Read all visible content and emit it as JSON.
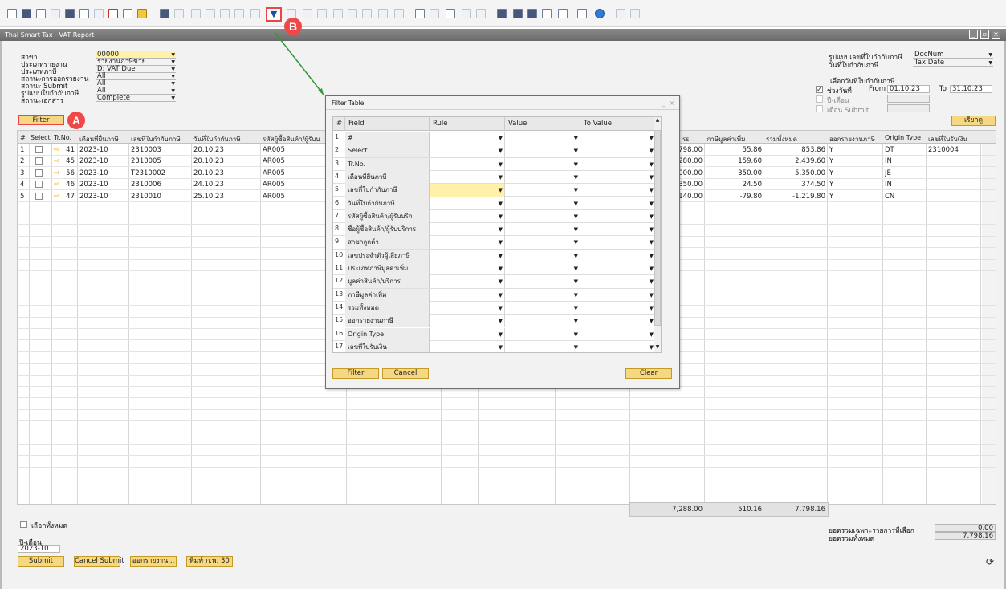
{
  "toolbar": {
    "filter_icon": "filter-icon"
  },
  "callouts": {
    "a": "A",
    "b": "B"
  },
  "window": {
    "title": "Thai Smart Tax - VAT Report"
  },
  "criteria": {
    "labels": [
      "สาขา",
      "ประเภทรายงาน",
      "ประเภทภาษี",
      "สถานะการออกรายงาน",
      "สถานะ Submit",
      "รูปแบบใบกำกับภาษี",
      "สถานะเอกสาร"
    ],
    "values": [
      "00000",
      "รายงานภาษีขาย",
      "D: VAT Due",
      "All",
      "All",
      "All",
      "Complete"
    ],
    "filter_button": "Filter"
  },
  "right_criteria": {
    "labels": [
      "รูปแบบเลขที่ใบกำกับภาษี",
      "วันที่ใบกำกับภาษี"
    ],
    "values": [
      "DocNum",
      "Tax Date"
    ],
    "group_title": "เลือกวันที่ใบกำกับภาษี",
    "opt1": "ช่วงวันที่",
    "opt2": "ปี-เดือน",
    "opt3": "เดือน Submit",
    "from_label": "From",
    "from_value": "01.10.23",
    "to_label": "To",
    "to_value": "31.10.23",
    "search_button": "เรียกดู"
  },
  "grid": {
    "headers": [
      "#",
      "Select",
      "Tr.No.",
      "เดือนที่ยื่นภาษี",
      "เลขที่ใบกำกับภาษี",
      "วันที่ใบกำกับภาษี",
      "รหัสผู้ซื้อสินค้า/ผู้รับบ",
      "",
      "",
      "",
      "",
      "",
      "",
      "รวมทั้งหมด",
      "ออกรายงานภาษี",
      "Origin Type",
      "เลขที่ใบรับเงิน"
    ],
    "rows": [
      {
        "n": "1",
        "tr": "41",
        "month": "2023-10",
        "inv": "2310003",
        "date": "20.10.23",
        "cust": "AR005",
        "amt": "798.00",
        "vat": "55.86",
        "total": "853.86",
        "issued": "Y",
        "origin": "DT",
        "rcpt": "2310004"
      },
      {
        "n": "2",
        "tr": "45",
        "month": "2023-10",
        "inv": "2310005",
        "date": "20.10.23",
        "cust": "AR005",
        "amt": "280.00",
        "vat": "159.60",
        "total": "2,439.60",
        "issued": "Y",
        "origin": "IN",
        "rcpt": ""
      },
      {
        "n": "3",
        "tr": "56",
        "month": "2023-10",
        "inv": "T2310002",
        "date": "20.10.23",
        "cust": "AR005",
        "amt": "000.00",
        "vat": "350.00",
        "total": "5,350.00",
        "issued": "Y",
        "origin": "JE",
        "rcpt": ""
      },
      {
        "n": "4",
        "tr": "46",
        "month": "2023-10",
        "inv": "2310006",
        "date": "24.10.23",
        "cust": "AR005",
        "amt": "350.00",
        "vat": "24.50",
        "total": "374.50",
        "issued": "Y",
        "origin": "IN",
        "rcpt": ""
      },
      {
        "n": "5",
        "tr": "47",
        "month": "2023-10",
        "inv": "2310010",
        "date": "25.10.23",
        "cust": "AR005",
        "amt": "140.00",
        "vat": "-79.80",
        "total": "-1,219.80",
        "issued": "Y",
        "origin": "CN",
        "rcpt": ""
      }
    ],
    "hdr_partial_rs": "รs",
    "hdr_vat": "ภาษีมูลค่าเพิ่ม",
    "totals": {
      "amount": "7,288.00",
      "vat": "510.16",
      "total": "7,798.16"
    }
  },
  "bottom": {
    "select_all": "เลือกทั้งหมด",
    "period_label": "ปี-เดือน",
    "period_value": "2023-10",
    "buttons": [
      "Submit",
      "Cancel Submit",
      "ออกรายงาน...",
      "พิมพ์ ภ.พ. 30"
    ],
    "sum_selected_label": "ยอดรวมเฉพาะรายการที่เลือก",
    "sum_selected_value": "0.00",
    "sum_all_label": "ยอดรวมทั้งหมด",
    "sum_all_value": "7,798.16"
  },
  "dialog": {
    "title": "Filter Table",
    "headers": [
      "#",
      "Field",
      "Rule",
      "Value",
      "To Value"
    ],
    "rows": [
      {
        "n": "1",
        "field": "#"
      },
      {
        "n": "2",
        "field": "Select"
      },
      {
        "n": "3",
        "field": "Tr.No."
      },
      {
        "n": "4",
        "field": "เดือนที่ยื่นภาษี"
      },
      {
        "n": "5",
        "field": "เลขที่ใบกำกับภาษี"
      },
      {
        "n": "6",
        "field": "วันที่ใบกำกับภาษี"
      },
      {
        "n": "7",
        "field": "รหัสผู้ซื้อสินค้า/ผู้รับบริก"
      },
      {
        "n": "8",
        "field": "ชื่อผู้ซื้อสินค้า/ผู้รับบริการ"
      },
      {
        "n": "9",
        "field": "สาขาลูกค้า"
      },
      {
        "n": "10",
        "field": "เลขประจำตัวผู้เสียภาษี"
      },
      {
        "n": "11",
        "field": "ประเภทภาษีมูลค่าเพิ่ม"
      },
      {
        "n": "12",
        "field": "มูลค่าสินค้า/บริการ"
      },
      {
        "n": "13",
        "field": "ภาษีมูลค่าเพิ่ม"
      },
      {
        "n": "14",
        "field": "รวมทั้งหมด"
      },
      {
        "n": "15",
        "field": "ออกรายงานภาษี"
      },
      {
        "n": "16",
        "field": "Origin Type"
      },
      {
        "n": "17",
        "field": "เลขที่ใบรับเงิน"
      }
    ],
    "buttons": {
      "filter": "Filter",
      "cancel": "Cancel",
      "clear": "Clear"
    }
  }
}
